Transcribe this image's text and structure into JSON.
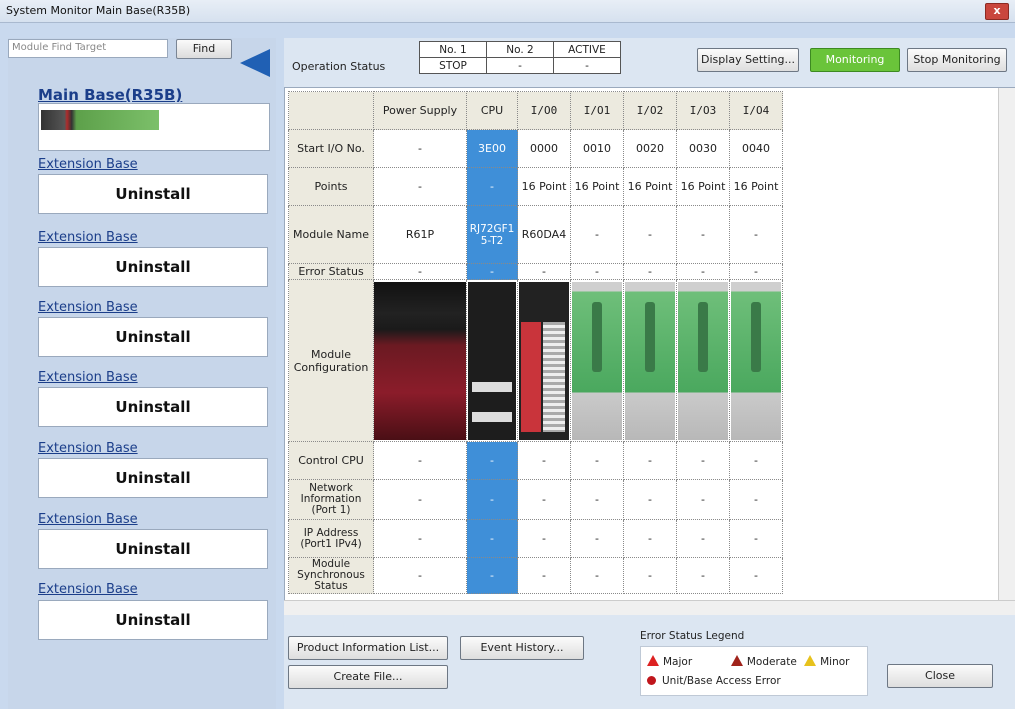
{
  "window": {
    "title": "System Monitor Main Base(R35B)",
    "close_label": "x"
  },
  "finder": {
    "placeholder": "Module Find Target",
    "find_label": "Find"
  },
  "sidebar": {
    "main_base": {
      "title": "Main Base(R35B)"
    },
    "extension_bases": [
      {
        "title": "Extension Base",
        "status": "Uninstall"
      },
      {
        "title": "Extension Base",
        "status": "Uninstall"
      },
      {
        "title": "Extension Base",
        "status": "Uninstall"
      },
      {
        "title": "Extension Base",
        "status": "Uninstall"
      },
      {
        "title": "Extension Base",
        "status": "Uninstall"
      },
      {
        "title": "Extension Base",
        "status": "Uninstall"
      },
      {
        "title": "Extension Base",
        "status": "Uninstall"
      }
    ]
  },
  "operation": {
    "label": "Operation Status",
    "headers": [
      "No. 1",
      "No. 2",
      "ACTIVE"
    ],
    "values": [
      "STOP",
      "-",
      "-"
    ]
  },
  "toolbar": {
    "display_setting": "Display Setting...",
    "monitoring": "Monitoring",
    "stop_monitoring": "Stop Monitoring"
  },
  "grid": {
    "columns": [
      "Power Supply",
      "CPU",
      "I/O0",
      "I/O1",
      "I/O2",
      "I/O3",
      "I/O4"
    ],
    "rows": {
      "start_io": {
        "label": "Start I/O No.",
        "cells": [
          "-",
          "3E00",
          "0000",
          "0010",
          "0020",
          "0030",
          "0040"
        ]
      },
      "points": {
        "label": "Points",
        "cells": [
          "-",
          "-",
          "16 Point",
          "16 Point",
          "16 Point",
          "16 Point",
          "16 Point"
        ]
      },
      "module_name": {
        "label": "Module Name",
        "cells": [
          "R61P",
          "RJ72GF15-T2",
          "R60DA4",
          "-",
          "-",
          "-",
          "-"
        ]
      },
      "error_status": {
        "label": "Error Status",
        "cells": [
          "-",
          "-",
          "-",
          "-",
          "-",
          "-",
          "-"
        ]
      },
      "module_config": {
        "label": "Module Configuration"
      },
      "control_cpu": {
        "label": "Control CPU",
        "cells": [
          "-",
          "-",
          "-",
          "-",
          "-",
          "-",
          "-"
        ]
      },
      "network_info": {
        "label": "Network Information (Port 1)",
        "cells": [
          "-",
          "-",
          "-",
          "-",
          "-",
          "-",
          "-"
        ]
      },
      "ip_address": {
        "label": "IP Address (Port1 IPv4)",
        "cells": [
          "-",
          "-",
          "-",
          "-",
          "-",
          "-",
          "-"
        ]
      },
      "sync_status": {
        "label": "Module Synchronous Status",
        "cells": [
          "-",
          "-",
          "-",
          "-",
          "-",
          "-",
          "-"
        ]
      }
    }
  },
  "bottom": {
    "product_info": "Product Information List...",
    "event_history": "Event History...",
    "create_file": "Create File...",
    "close": "Close"
  },
  "legend": {
    "title": "Error Status Legend",
    "major": "Major",
    "moderate": "Moderate",
    "minor": "Minor",
    "access_error": "Unit/Base Access Error"
  },
  "colors": {
    "cpu_column": "#3f8fd8",
    "monitoring": "#6ac43a",
    "accent": "#2060b4"
  }
}
